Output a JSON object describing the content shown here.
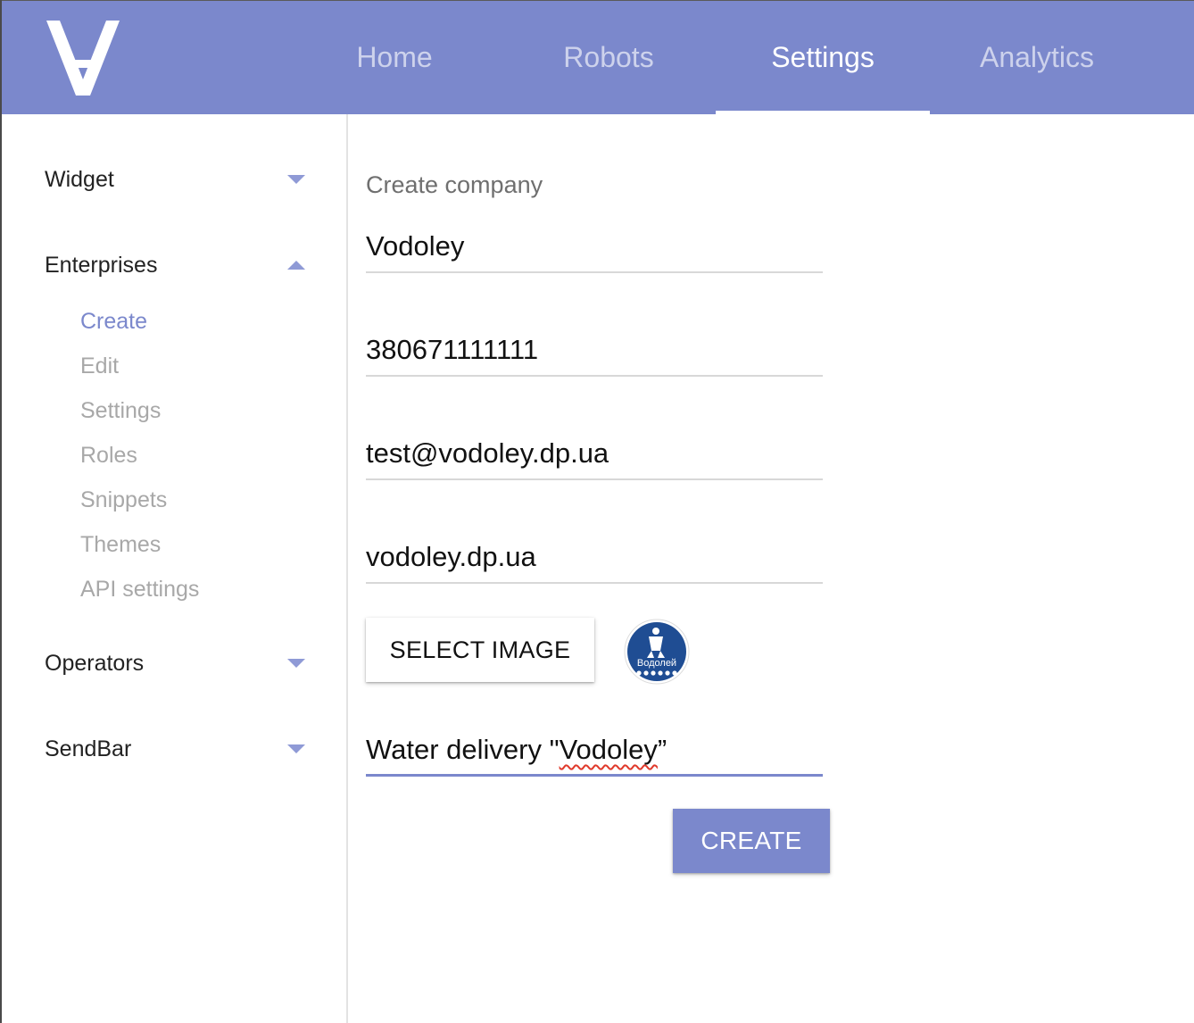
{
  "colors": {
    "accent": "#7b88cc",
    "header_bg": "#7b88cc",
    "muted_text": "#a8a8a8"
  },
  "header": {
    "logo_icon": "upside-down-A-logo",
    "nav": [
      {
        "label": "Home"
      },
      {
        "label": "Robots"
      },
      {
        "label": "Settings",
        "active": true
      },
      {
        "label": "Analytics"
      }
    ]
  },
  "sidebar": {
    "groups": [
      {
        "label": "Widget",
        "expanded": false
      },
      {
        "label": "Enterprises",
        "expanded": true,
        "items": [
          {
            "label": "Create",
            "active": true
          },
          {
            "label": "Edit"
          },
          {
            "label": "Settings"
          },
          {
            "label": "Roles"
          },
          {
            "label": "Snippets"
          },
          {
            "label": "Themes"
          },
          {
            "label": "API settings"
          }
        ]
      },
      {
        "label": "Operators",
        "expanded": false
      },
      {
        "label": "SendBar",
        "expanded": false
      }
    ]
  },
  "form": {
    "title": "Create company",
    "fields": {
      "name": "Vodoley",
      "phone": "380671111111",
      "email": "test@vodoley.dp.ua",
      "website": "vodoley.dp.ua",
      "description_prefix": "Water delivery \"",
      "description_misspelled": "Vodoley",
      "description_suffix": "”"
    },
    "select_image_label": "SELECT IMAGE",
    "logo_preview_text": "Водолей",
    "create_label": "CREATE"
  }
}
